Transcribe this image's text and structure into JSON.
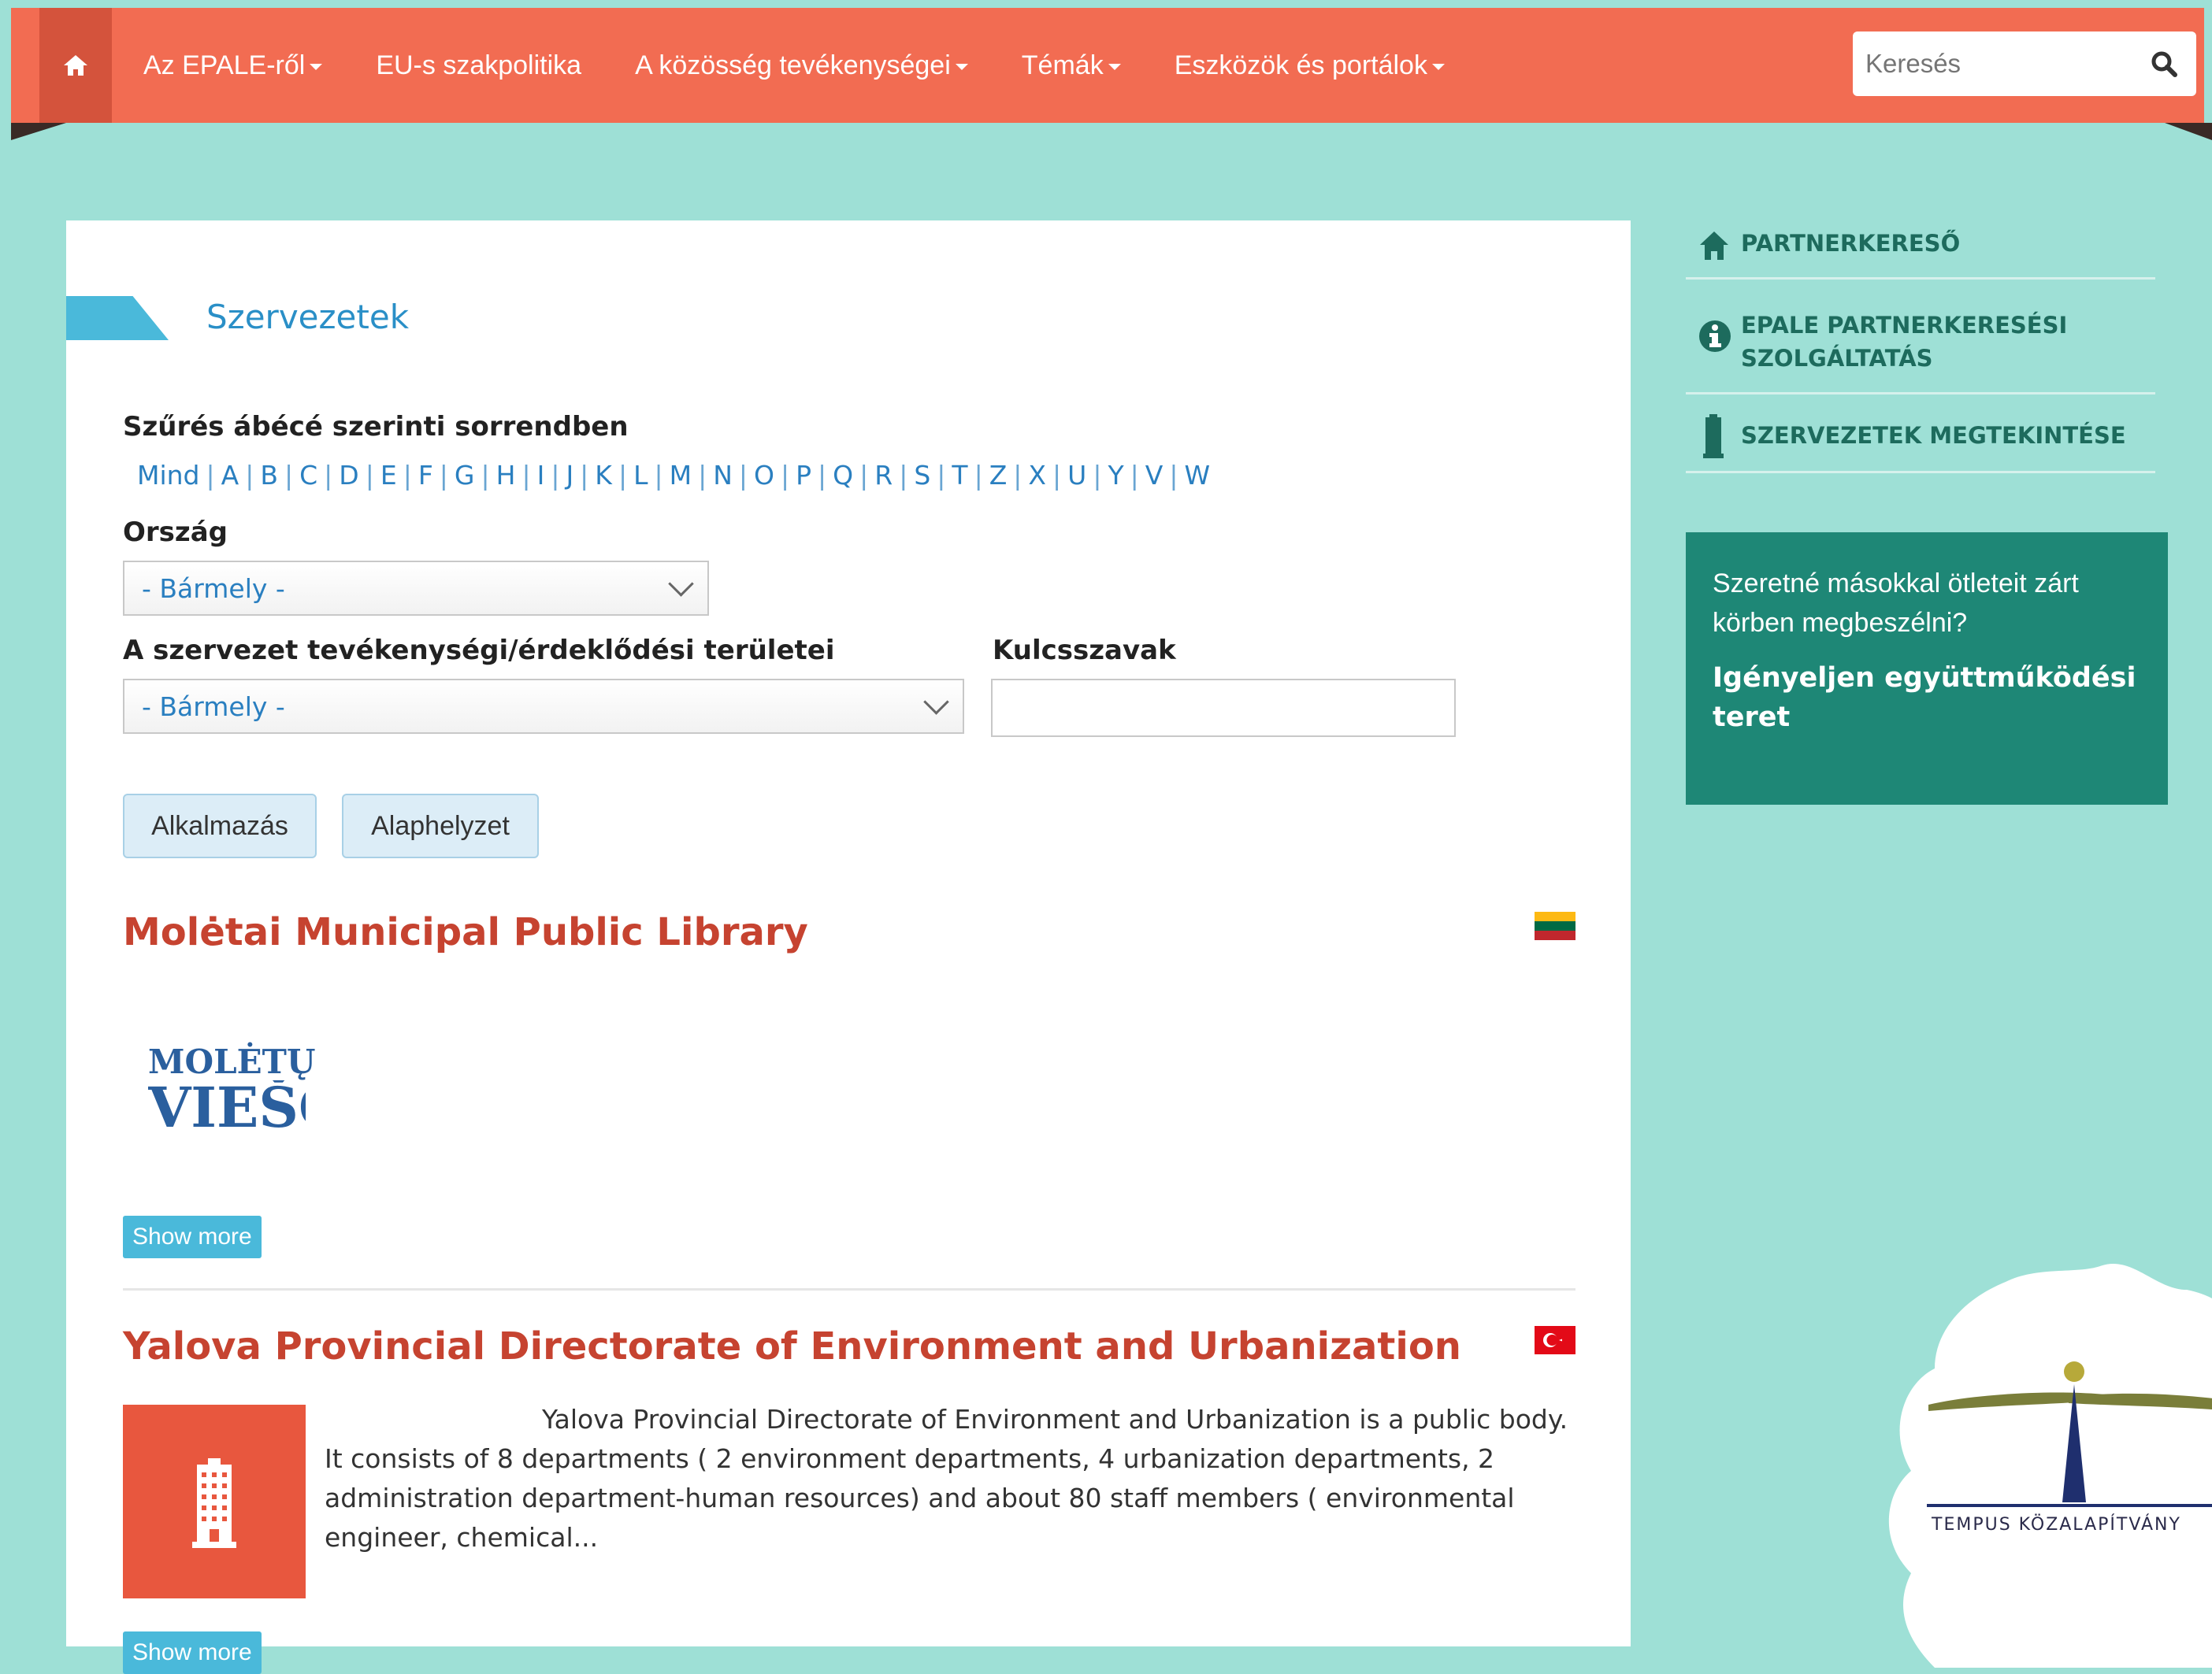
{
  "header": {
    "nav": [
      {
        "label": "Az EPALE-ről",
        "dropdown": true
      },
      {
        "label": "EU-s szakpolitika",
        "dropdown": false
      },
      {
        "label": "A közösség tevékenységei",
        "dropdown": true
      },
      {
        "label": "Témák",
        "dropdown": true
      },
      {
        "label": "Eszközök és portálok",
        "dropdown": true
      }
    ],
    "search_placeholder": "Keresés",
    "accent": "#f26c52"
  },
  "main": {
    "section_title": "Szervezetek",
    "filter_label": "Szűrés ábécé szerinti sorrendben",
    "letters": [
      "Mind",
      "A",
      "B",
      "C",
      "D",
      "E",
      "F",
      "G",
      "H",
      "I",
      "J",
      "K",
      "L",
      "M",
      "N",
      "O",
      "P",
      "Q",
      "R",
      "S",
      "T",
      "Z",
      "X",
      "U",
      "Y",
      "V",
      "W"
    ],
    "country_label": "Ország",
    "country_value": "- Bármely -",
    "activity_label": "A szervezet tevékenységi/érdeklődési területei",
    "activity_value": "- Bármely -",
    "keywords_label": "Kulcsszavak",
    "keywords_value": "",
    "apply_label": "Alkalmazás",
    "reset_label": "Alaphelyzet",
    "results": [
      {
        "title": "Molėtai Municipal Public Library",
        "logo_line1": "MOLĖTŲ",
        "logo_line2": "VIEŠO",
        "show_more": "Show more",
        "flag": "lithuania-flag"
      },
      {
        "title": "Yalova Provincial Directorate of Environment and Urbanization",
        "description": "Yalova Provincial Directorate of Environment and Urbanization is a public body. It consists of 8 departments ( 2 environment departments, 4 urbanization departments, 2 administration department-human resources) and about 80 staff members ( environmental engineer, chemical...",
        "show_more": "Show more",
        "flag": "turkey-flag"
      }
    ]
  },
  "sidebar": {
    "links": [
      {
        "label": "PARTNERKERESŐ",
        "icon": "home-icon"
      },
      {
        "label": "EPALE PARTNERKERESÉSI SZOLGÁLTATÁS",
        "icon": "info-icon"
      },
      {
        "label": "SZERVEZETEK MEGTEKINTÉSE",
        "icon": "building-icon"
      }
    ],
    "promo_text": "Szeretné másokkal ötleteit zárt körben megbeszélni?",
    "promo_link": "Igényeljen együttműködési teret"
  },
  "badge": {
    "text": "TEMPUS KÖZALAPÍTVÁNY"
  }
}
